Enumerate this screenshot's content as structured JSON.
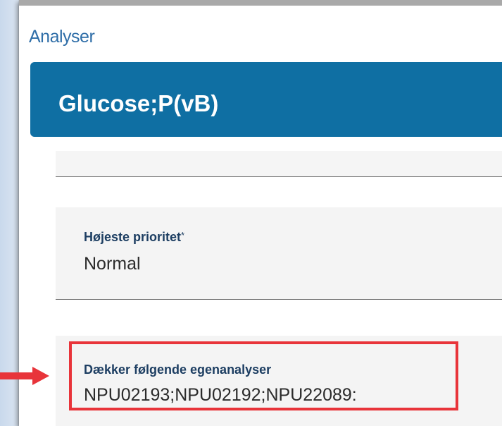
{
  "section": {
    "title": "Analyser"
  },
  "header": {
    "title": "Glucose;P(vB)"
  },
  "fields": {
    "priority": {
      "label": "Højeste prioritet",
      "required_mark": "*",
      "value": "Normal"
    },
    "coverage": {
      "label": "Dækker følgende egenanalyser",
      "value": "NPU02193;NPU02192;NPU22089:"
    }
  },
  "annotation": {
    "highlight_color": "#e8343a",
    "arrow_icon": "arrow-right-icon"
  },
  "colors": {
    "header_bg": "#0f6fa3",
    "title_text": "#2f6ea8",
    "label_text": "#1d3e62"
  }
}
